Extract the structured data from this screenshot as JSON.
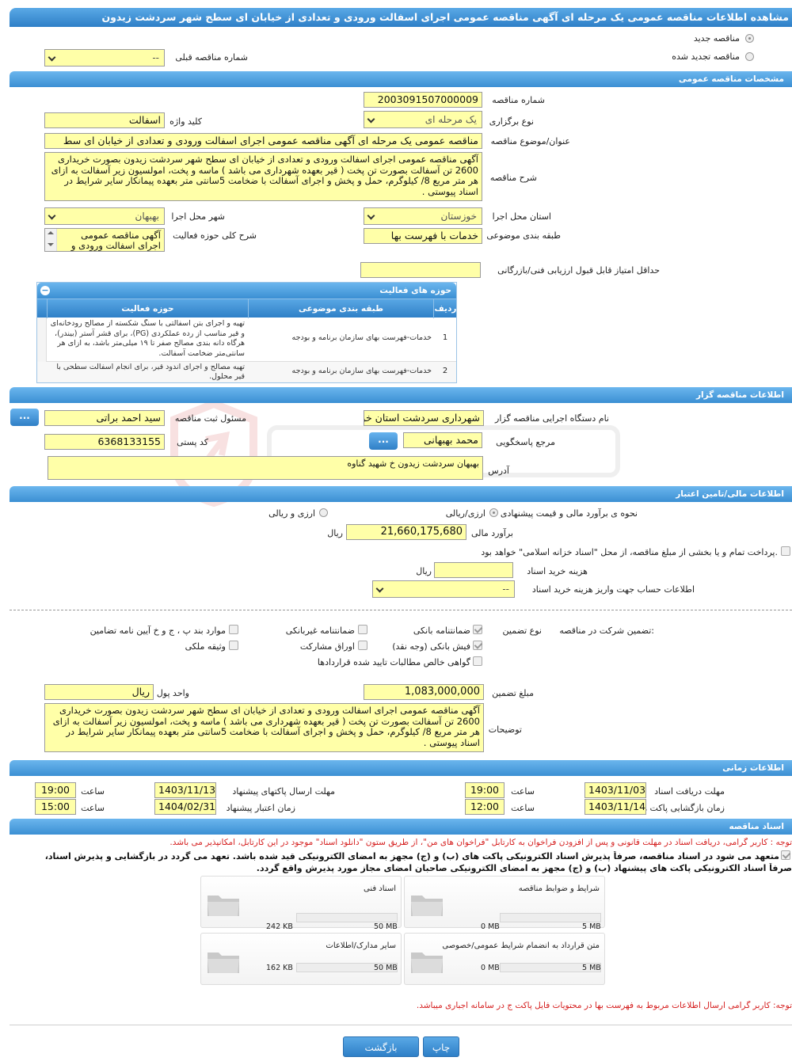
{
  "page": {
    "title": "مشاهده اطلاعات مناقصه عمومی یک مرحله ای آگهی مناقصه عمومی اجرای اسفالت ورودی و تعدادی از خیابان ای سطح شهر سردشت زیدون"
  },
  "type_radios": {
    "new_label": "مناقصه جدید",
    "renewed_label": "مناقصه تجدید شده",
    "prev_no_label": "شماره مناقصه قبلی",
    "prev_no_value": "--"
  },
  "general": {
    "header": "مشخصات مناقصه عمومی",
    "tender_no_label": "شماره مناقصه",
    "tender_no": "2003091507000009",
    "holding_type_label": "نوع برگزاری",
    "holding_type": "یک مرحله ای",
    "keyword_label": "کلید واژه",
    "keyword": "اسفالت",
    "subject_label": "عنوان/موضوع مناقصه",
    "subject": "مناقصه عمومی یک مرحله ای آگهی مناقصه عمومی اجرای اسفالت ورودی و تعدادی از خیابان ای سط",
    "description_label": "شرح مناقصه",
    "description": "آگهی مناقصه عمومی اجرای اسفالت ورودی و تعدادی از خیابان ای سطح شهر سردشت زیدون بصورت خریداری 2600 تن آسفالت بصورت تن پخت ( قیر بعهده شهرداری می باشد ) ماسه و پخت، امولسیون زیر آسفالت به ازای هر متر مربع 8/ کیلوگرم، حمل و پخش و اجرای آسفالت با ضخامت 5سانتی متر بعهده پیمانکار سایر شرایط در اسناد پیوستی .",
    "province_label": "استان محل اجرا",
    "province": "خوزستان",
    "city_label": "شهر محل اجرا",
    "city": "بهبهان",
    "category_label": "طبقه بندی موضوعی",
    "category": "خدمات با فهرست بها",
    "scope_label": "شرح کلی حوزه فعالیت",
    "scope": "آگهی مناقصه عمومی اجرای اسفالت ورودی و",
    "min_score_label": "حداقل امتیاز قابل قبول ارزیابی فنی/بازرگانی",
    "min_score": ""
  },
  "activity": {
    "header": "حوزه های فعالیت",
    "col_row": "ردیف",
    "col_category": "طبقه بندی موضوعی",
    "col_scope": "حوزه فعالیت",
    "rows": [
      {
        "no": "1",
        "category": "خدمات-فهرست بهای سازمان برنامه و بودجه",
        "scope": "تهیه و اجرای بتن آسفالتی با سنگ شکسته از مصالح رودخانه‌ای و قیر مناسب از رده عملکردی (PG)، برای قشر آستر (بیندر)، هرگاه دانه بندی مصالح صفر تا ۱۹ میلی‌متر باشد، به ازای هر سانتی‌متر ضخامت آسفالت."
      },
      {
        "no": "2",
        "category": "خدمات-فهرست بهای سازمان برنامه و بودجه",
        "scope": "تهیه مصالح و اجرای اندود قیر، برای انجام آسفالت سطحی با قیر محلول."
      }
    ]
  },
  "organizer": {
    "header": "اطلاعات مناقصه گزار",
    "org_label": "نام دستگاه اجرایی مناقصه گزار",
    "org": "شهرداری سردشت استان خوزستان",
    "registrar_label": "مسئول ثبت مناقصه",
    "registrar": "سید احمد براتی",
    "ref_label": "مرجع پاسخگویی",
    "ref": "محمد بهبهانی",
    "postal_label": "کد پستی",
    "postal": "6368133155",
    "address_label": "آدرس",
    "address": "بهبهان سردشت زیدون خ شهید گناوه",
    "dots": "..."
  },
  "finance": {
    "header": "اطلاعات مالی/تامین اعتبار",
    "estimate_method_label": "نحوه ی برآورد مالی و قیمت پیشنهادی",
    "opt_rial": "ارزی/ریالی",
    "opt_fx": "ارزی و ریالی",
    "estimate_label": "برآورد مالی",
    "estimate": "21,660,175,680",
    "rial": "ریال",
    "treasury_text": "پرداخت تمام و یا بخشی از مبلغ مناقصه، از محل \"اسناد خزانه اسلامی\" خواهد بود.",
    "doc_cost_label": "هزینه خرید اسناد",
    "doc_cost": "",
    "account_label": "اطلاعات حساب جهت واریز هزینه خرید اسناد",
    "account": "--"
  },
  "guarantee": {
    "company_label": "تضمین شرکت در مناقصه:",
    "type_label": "نوع تضمین",
    "bank_guarantee": "ضمانتنامه بانکی",
    "non_bank": "ضمانتنامه غیربانکی",
    "items_p": "موارد بند پ ، ج و خ آیین نامه تضامین",
    "bank_receipt": "فیش بانکی (وجه نقد)",
    "bonds": "اوراق مشارکت",
    "property": "وثیقه ملکی",
    "receivables": "گواهی خالص مطالبات تایید شده قراردادها",
    "amount_label": "مبلغ تضمین",
    "amount": "1,083,000,000",
    "currency_label": "واحد پول",
    "currency": "ریال",
    "notes_label": "توضیحات",
    "notes": "آگهی مناقصه عمومی اجرای اسفالت ورودی و تعدادی از خیابان ای سطح شهر سردشت زیدون بصورت خریداری 2600 تن آسفالت بصورت تن پخت ( قیر بعهده شهرداری می باشد ) ماسه و پخت، امولسیون زیر آسفالت به ازای هر متر مربع 8/ کیلوگرم، حمل و پخش و اجرای آسفالت با ضخامت 5سانتی متر بعهده پیمانکار سایر شرایط در اسناد پیوستی ."
  },
  "timing": {
    "header": "اطلاعات زمانی",
    "doc_receive_label": "مهلت دریافت اسناد",
    "doc_receive_date": "1403/11/03",
    "doc_receive_time": "19:00",
    "submit_label": "مهلت ارسال پاکتهای پیشنهاد",
    "submit_date": "1403/11/13",
    "submit_time": "19:00",
    "open_label": "زمان بازگشایی پاکت ها",
    "open_date": "1403/11/14",
    "open_time": "12:00",
    "valid_label": "زمان اعتبار پیشنهاد",
    "valid_date": "1404/02/31",
    "valid_time": "15:00",
    "time_label": "ساعت"
  },
  "docs": {
    "header": "اسناد مناقصه",
    "note1": "توجه : کاربر گرامی، دریافت اسناد در مهلت قانونی و پس از افزودن فراخوان به کارتابل \"فراخوان های من\"، از طریق ستون \"دانلود اسناد\" موجود در این کارتابل، امکانپذیر می باشد.",
    "commit1": "متعهد می شود در اسناد مناقصه، صرفاً پذیرش اسناد الکترونیکی پاکت های (ب) و (ج) مجهز به امضای الکترونیکی قید شده باشد. تعهد می گردد در بازگشایی و پذیرش اسناد،",
    "commit2": "صرفاً اسناد الکترونیکی پاکت های پیشنهاد (ب) و (ج) مجهز به امضای الکترونیکی صاحبان امضای مجاز مورد پذیرش واقع گردد.",
    "files": [
      {
        "name": "شرایط و ضوابط مناقصه",
        "max": "5 MB",
        "used": "0 MB"
      },
      {
        "name": "اسناد فنی",
        "max": "50 MB",
        "used": "242 KB"
      },
      {
        "name": "متن قرارداد به انضمام شرایط عمومی/خصوصی",
        "max": "5 MB",
        "used": "0 MB"
      },
      {
        "name": "سایر مدارک/اطلاعات",
        "max": "50 MB",
        "used": "162 KB"
      }
    ],
    "note2": "توجه: کاربر گرامی ارسال اطلاعات مربوط به فهرست بها در محتویات فایل پاکت ج در سامانه اجباری میباشد."
  },
  "actions": {
    "print": "چاپ",
    "back": "بازگشت"
  }
}
